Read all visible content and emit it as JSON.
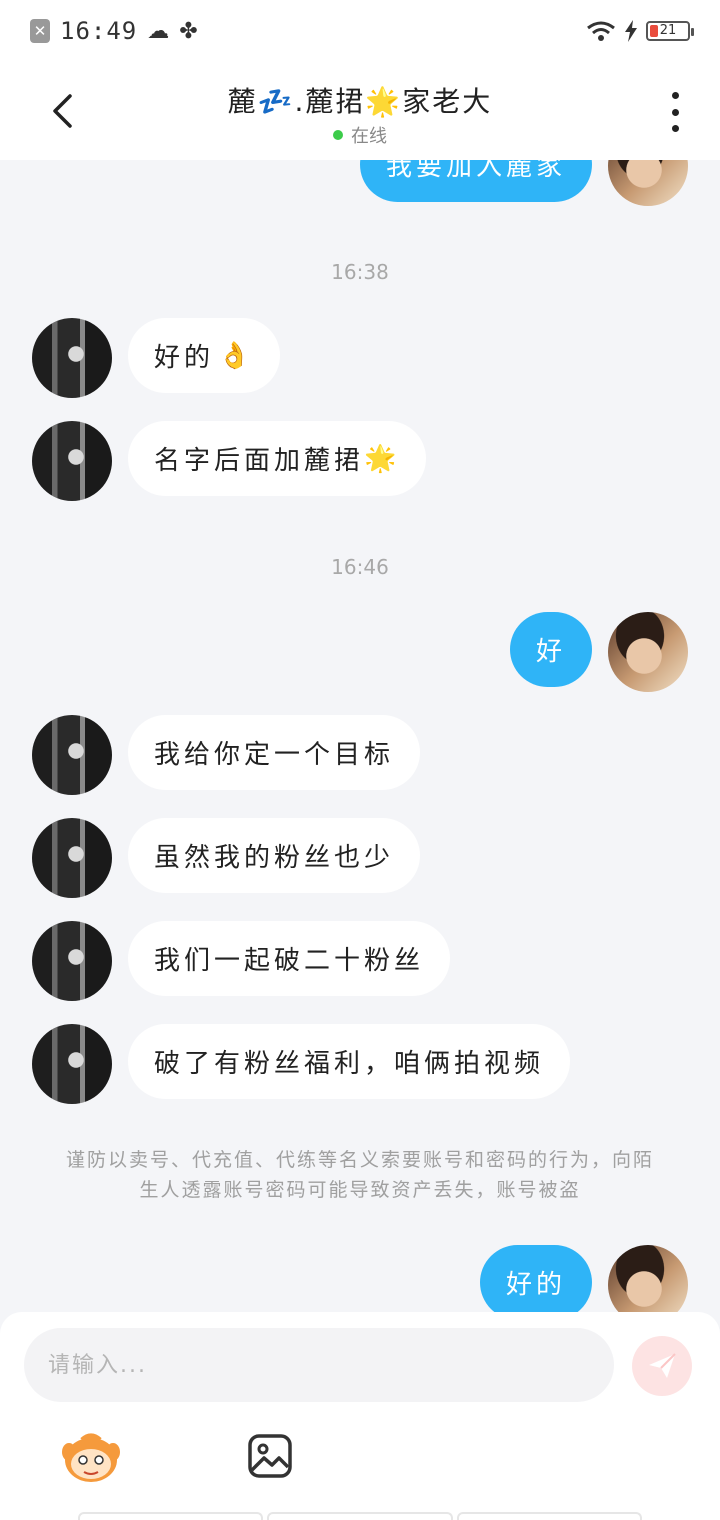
{
  "status_bar": {
    "time": "16:49",
    "battery": "21",
    "icons": [
      "close-square-icon",
      "cloud-icon",
      "pinwheel-icon",
      "wifi-icon",
      "charging-icon",
      "battery-icon"
    ]
  },
  "header": {
    "title": "麓💤.麓捃🌟家老大",
    "status": "在线",
    "icons": [
      "back-chevron-icon",
      "more-vertical-icon"
    ]
  },
  "messages": [
    {
      "side": "out",
      "text": "我要加入麓家"
    },
    {
      "type": "time",
      "text": "16:38"
    },
    {
      "side": "in",
      "text": "好的",
      "emoji": "👌"
    },
    {
      "side": "in",
      "text": "名字后面加麓捃",
      "emoji": "🌟"
    },
    {
      "type": "time",
      "text": "16:46"
    },
    {
      "side": "out",
      "text": "好"
    },
    {
      "side": "in",
      "text": "我给你定一个目标"
    },
    {
      "side": "in",
      "text": "虽然我的粉丝也少"
    },
    {
      "side": "in",
      "text": "我们一起破二十粉丝"
    },
    {
      "side": "in",
      "text": "破了有粉丝福利，咱俩拍视频"
    },
    {
      "type": "notice",
      "text": "谨防以卖号、代充值、代练等名义索要账号和密码的行为，向陌生人透露账号密码可能导致资产丢失，账号被盗"
    },
    {
      "side": "out",
      "text": "好的"
    }
  ],
  "input": {
    "placeholder": "请输入...",
    "icons": [
      "send-icon",
      "mascot-icon",
      "image-icon"
    ]
  },
  "colors": {
    "outgoing_bubble": "#2fb4f7",
    "incoming_bubble": "#ffffff",
    "background": "#f4f5f8",
    "online": "#3ccb4a",
    "send_button": "#fde3e3"
  }
}
